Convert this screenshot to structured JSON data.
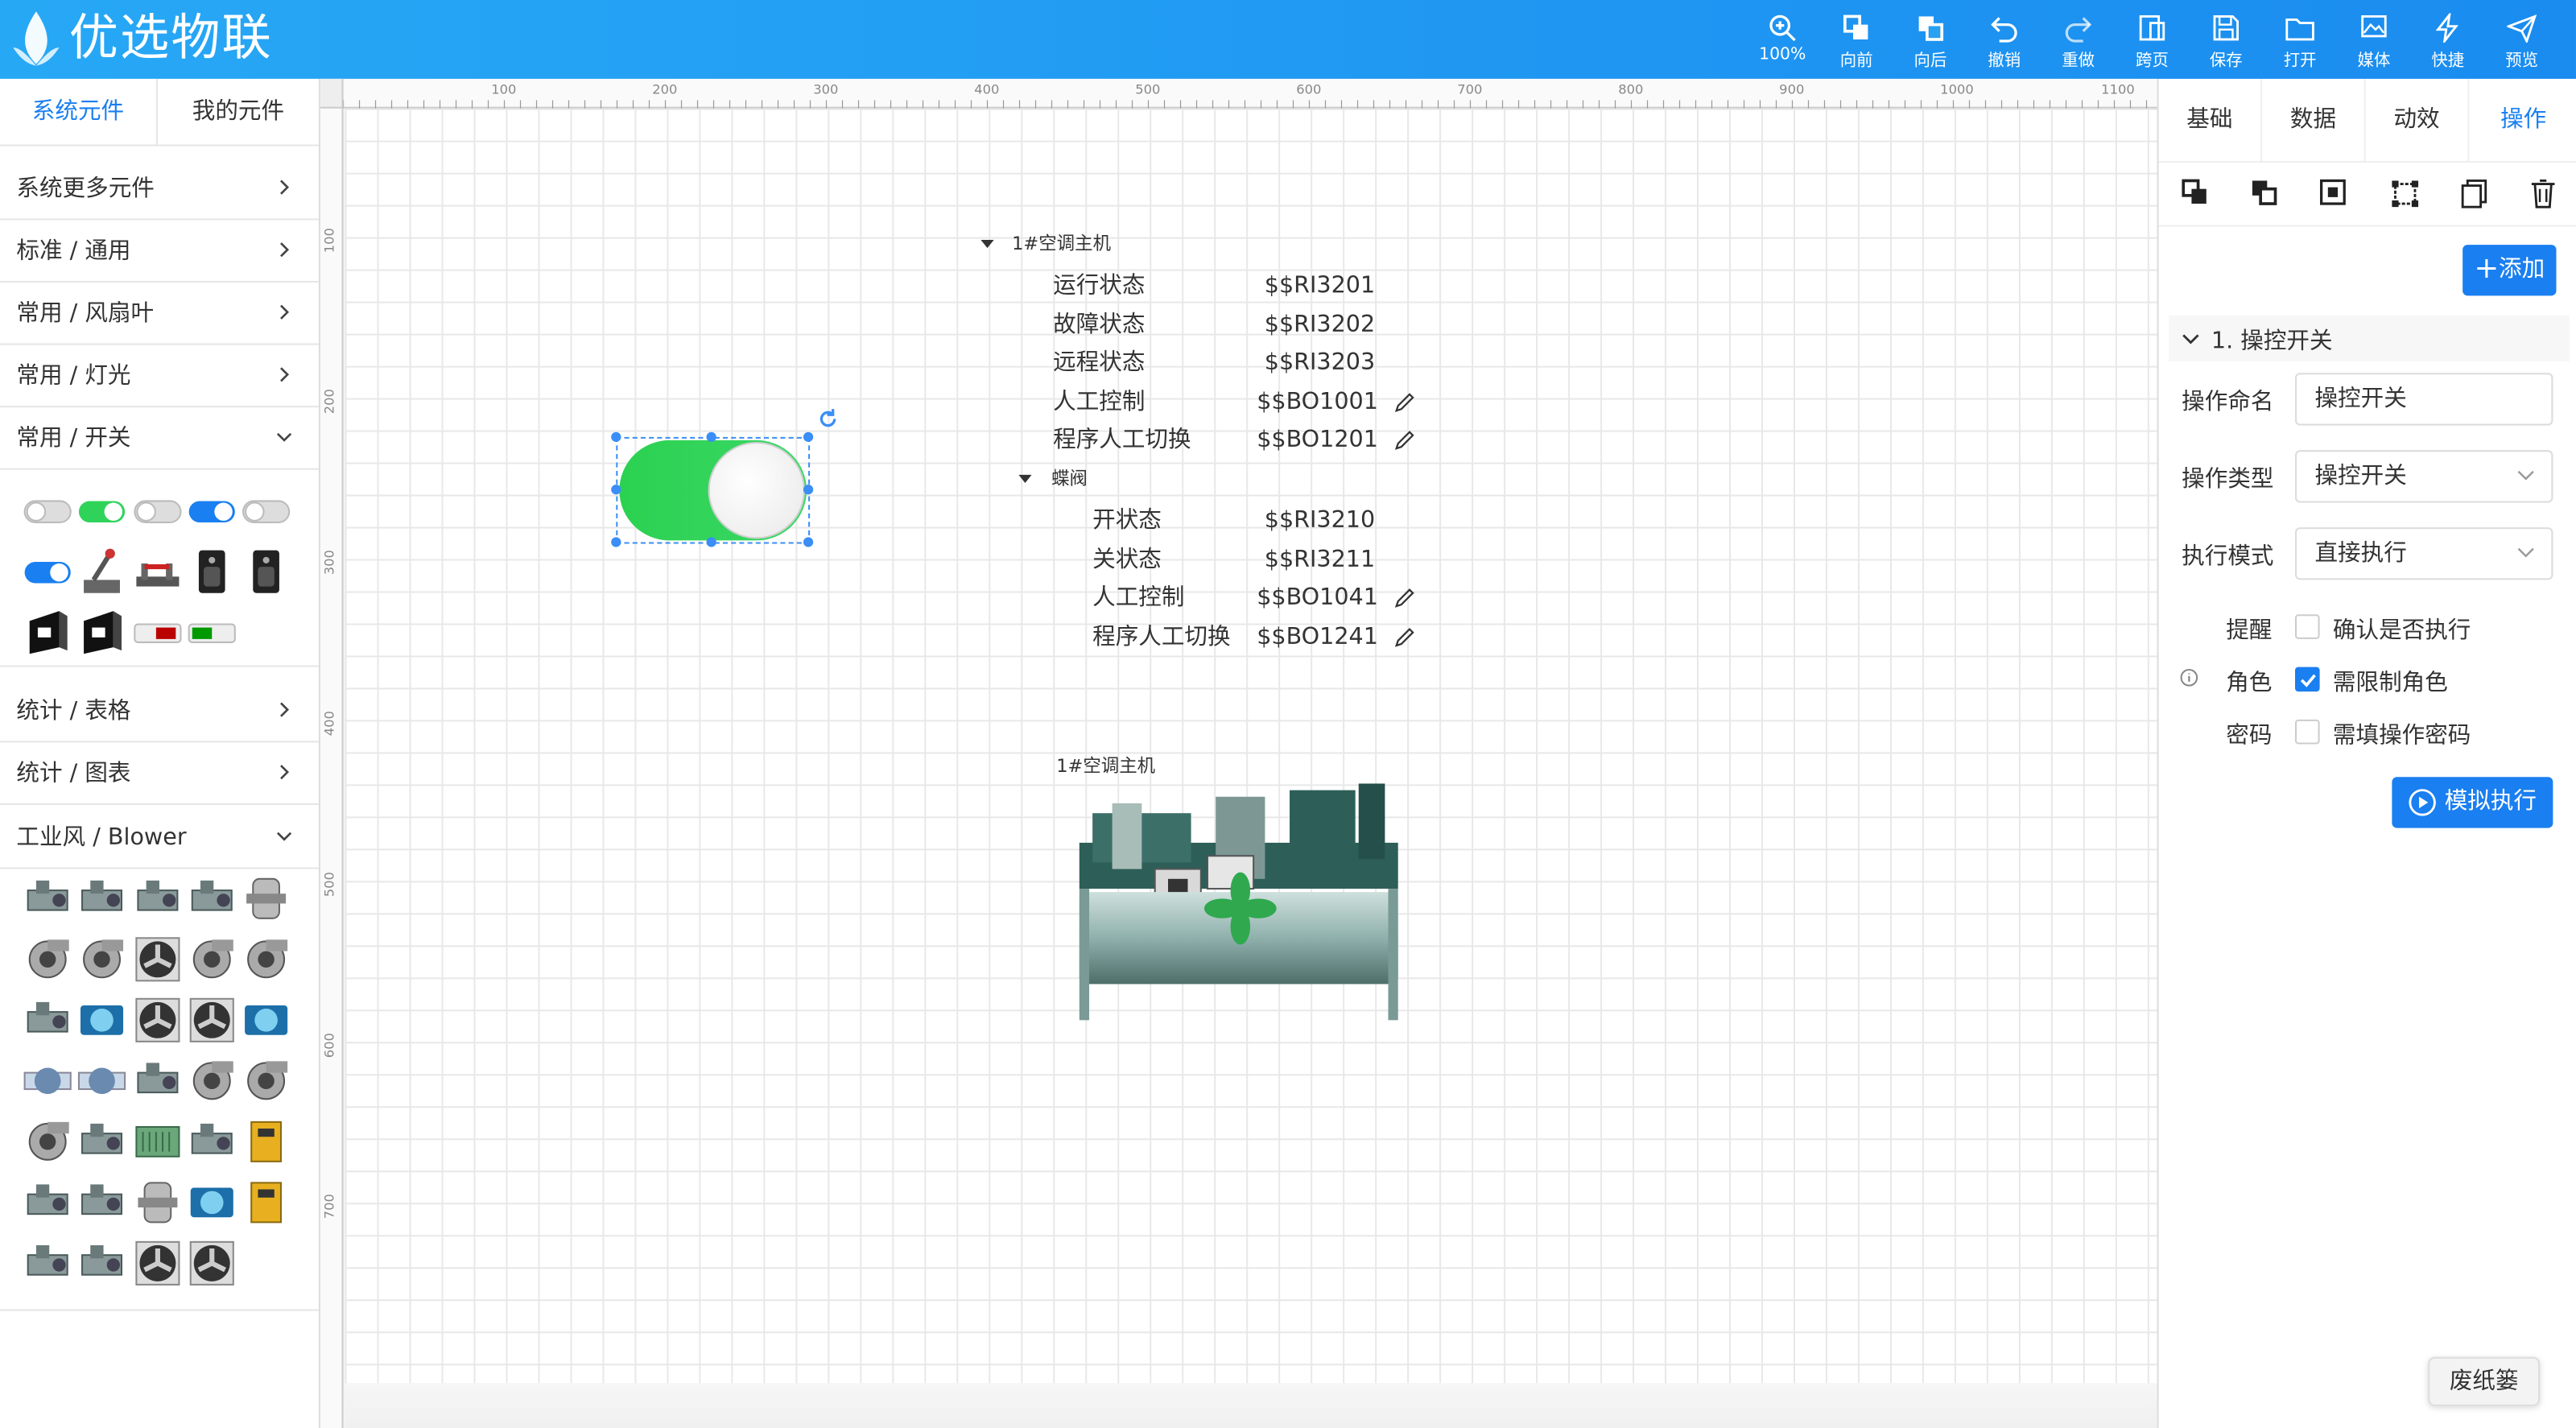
{
  "app": {
    "title": "优选物联"
  },
  "toolbar": [
    {
      "label": "100%",
      "icon": "zoom-icon"
    },
    {
      "label": "向前",
      "icon": "bring-forward-icon"
    },
    {
      "label": "向后",
      "icon": "send-backward-icon"
    },
    {
      "label": "撤销",
      "icon": "undo-icon"
    },
    {
      "label": "重做",
      "icon": "redo-icon"
    },
    {
      "label": "跨页",
      "icon": "cross-page-icon"
    },
    {
      "label": "保存",
      "icon": "save-icon"
    },
    {
      "label": "打开",
      "icon": "open-icon"
    },
    {
      "label": "媒体",
      "icon": "media-icon"
    },
    {
      "label": "快捷",
      "icon": "lightning-icon"
    },
    {
      "label": "预览",
      "icon": "send-icon"
    }
  ],
  "left": {
    "tabs": [
      "系统元件",
      "我的元件"
    ],
    "categories": [
      "系统更多元件",
      "标准 / 通用",
      "常用 / 风扇叶",
      "常用 / 灯光",
      "常用 / 开关",
      "统计 / 表格",
      "统计 / 图表",
      "工业风 / Blower"
    ]
  },
  "ruler": {
    "h": [
      "100",
      "200",
      "300",
      "400",
      "500",
      "600",
      "700",
      "800",
      "900",
      "1000",
      "1100"
    ],
    "v": [
      "100",
      "200",
      "300",
      "400",
      "500",
      "600",
      "700"
    ]
  },
  "tree": {
    "root": "1#空调主机",
    "items": [
      {
        "label": "运行状态",
        "value": "$$RI3201",
        "editable": false
      },
      {
        "label": "故障状态",
        "value": "$$RI3202",
        "editable": false
      },
      {
        "label": "远程状态",
        "value": "$$RI3203",
        "editable": false
      },
      {
        "label": "人工控制",
        "value": "$$BO1001",
        "editable": true
      },
      {
        "label": "程序人工切换",
        "value": "$$BO1201",
        "editable": true
      }
    ],
    "child": "蝶阀",
    "child_items": [
      {
        "label": "开状态",
        "value": "$$RI3210",
        "editable": false
      },
      {
        "label": "关状态",
        "value": "$$RI3211",
        "editable": false
      },
      {
        "label": "人工控制",
        "value": "$$BO1041",
        "editable": true
      },
      {
        "label": "程序人工切换",
        "value": "$$BO1241",
        "editable": true
      }
    ]
  },
  "chiller": {
    "label": "1#空调主机"
  },
  "right": {
    "tabs": [
      "基础",
      "数据",
      "动效",
      "操作"
    ],
    "active_tab": "操作",
    "add_label": "添加",
    "section_title": "1. 操控开关",
    "fields": {
      "name_label": "操作命名",
      "name_value": "操控开关",
      "type_label": "操作类型",
      "type_value": "操控开关",
      "mode_label": "执行模式",
      "mode_value": "直接执行"
    },
    "checks": {
      "remind_label": "提醒",
      "remind_text": "确认是否执行",
      "remind_checked": false,
      "role_label": "角色",
      "role_text": "需限制角色",
      "role_checked": true,
      "pwd_label": "密码",
      "pwd_text": "需填操作密码",
      "pwd_checked": false
    },
    "simulate_label": "模拟执行"
  },
  "trash": "废纸篓",
  "colors": {
    "primary": "#1a7ff0",
    "switch_green": "#2fd35a"
  }
}
